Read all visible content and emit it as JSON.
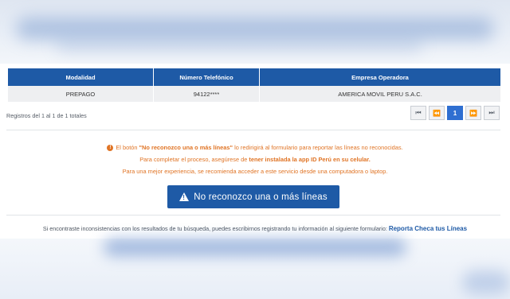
{
  "table": {
    "headers": [
      "Modalidad",
      "Número Telefónico",
      "Empresa Operadora"
    ],
    "rows": [
      [
        "PREPAGO",
        "94122****",
        "AMERICA MOVIL PERU S.A.C."
      ]
    ]
  },
  "registros_text": "Registros del 1 al 1 de 1 totales",
  "pagination": {
    "first_icon": "first-page-icon",
    "prev_icon": "prev-page-icon",
    "current_page": "1",
    "next_icon": "next-page-icon",
    "last_icon": "last-page-icon",
    "glyph_first": "⏮",
    "glyph_prev": "⏪",
    "glyph_next": "⏩",
    "glyph_last": "⏭"
  },
  "info": {
    "warning_icon": "warning-circle-icon",
    "line1_prefix": "El botón ",
    "line1_bold": "\"No reconozco una o más líneas\"",
    "line1_suffix": " lo redirigirá al formulario para reportar las líneas no reconocidas.",
    "line2_prefix": "Para completar el proceso, asegúrese de ",
    "line2_bold": "tener instalada la app ID Perú en su celular.",
    "line3": "Para una mejor experiencia, se recomienda acceder a este servicio desde una computadora o laptop."
  },
  "cta": {
    "icon": "warning-triangle-icon",
    "label": "No reconozco una o más líneas"
  },
  "footer": {
    "text": "Si encontraste inconsistencias con los resultados de tu búsqueda, puedes escribirnos registrando tu información al siguiente formulario: ",
    "link": "Reporta Checa tus Líneas"
  },
  "colors": {
    "primary": "#1e5aa6",
    "warning": "#e07425",
    "active_page": "#2f6fd1"
  }
}
